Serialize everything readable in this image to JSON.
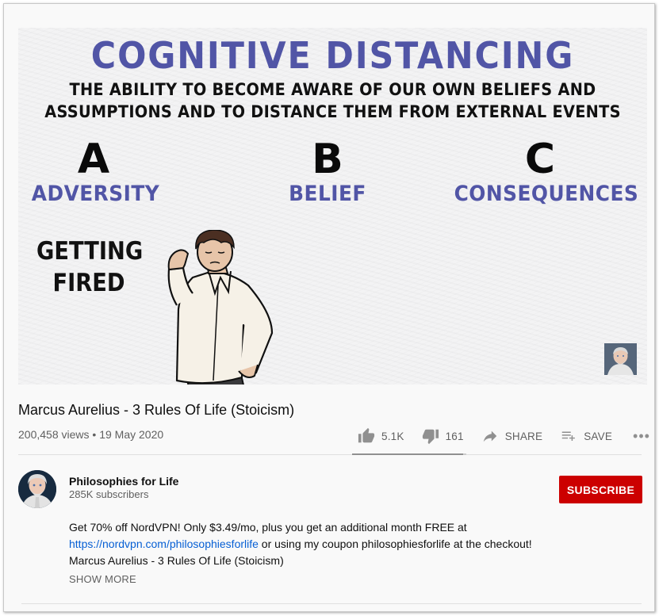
{
  "video": {
    "frame": {
      "heading": "COGNITIVE DISTANCING",
      "subheading_line1": "THE ABILITY TO BECOME AWARE OF OUR OWN BELIEFS AND",
      "subheading_line2": "ASSUMPTIONS AND TO DISTANCE THEM FROM EXTERNAL EVENTS",
      "columns": [
        {
          "letter": "A",
          "word": "ADVERSITY"
        },
        {
          "letter": "B",
          "word": "BELIEF"
        },
        {
          "letter": "C",
          "word": "CONSEQUENCES"
        }
      ],
      "example_line1": "GETTING",
      "example_line2": "FIRED"
    },
    "title": "Marcus Aurelius - 3 Rules Of Life (Stoicism)",
    "views": "200,458 views",
    "separator": "•",
    "date": "19 May 2020"
  },
  "actions": {
    "like_count": "5.1K",
    "dislike_count": "161",
    "share_label": "SHARE",
    "save_label": "SAVE",
    "more_label": "•••",
    "like_ratio": 0.97
  },
  "channel": {
    "name": "Philosophies for Life",
    "subscribers": "285K subscribers",
    "subscribe_label": "SUBSCRIBE"
  },
  "description": {
    "line1": "Get 70% off NordVPN! Only $3.49/mo, plus you get an additional month FREE at",
    "link": "https://nordvpn.com/philosophiesforlife",
    "line2_rest": " or using my coupon philosophiesforlife at the checkout!",
    "line3": "Marcus Aurelius - 3 Rules Of Life (Stoicism)",
    "show_more": "SHOW MORE"
  },
  "colors": {
    "accent_purple": "#5155a6",
    "subscribe_red": "#cc0000",
    "link_blue": "#065fd4"
  }
}
